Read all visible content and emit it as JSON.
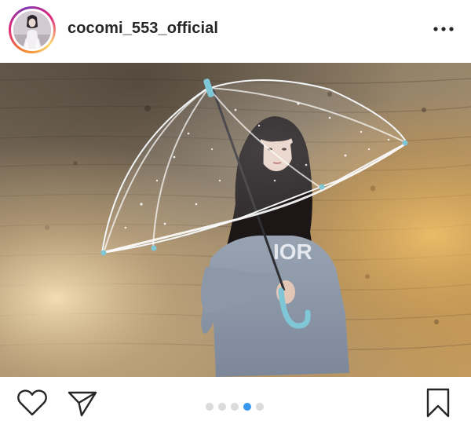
{
  "post": {
    "username": "cocomi_553_official",
    "photo_alt": "",
    "carousel": {
      "count": 5,
      "active_index": 3
    }
  },
  "icons": {
    "more": "more-horizontal-icon",
    "like": "heart-icon",
    "share": "paper-plane-icon",
    "save": "bookmark-icon"
  },
  "colors": {
    "text": "#262626",
    "dot_inactive": "#dbdbdb",
    "dot_active": "#3897f0"
  }
}
